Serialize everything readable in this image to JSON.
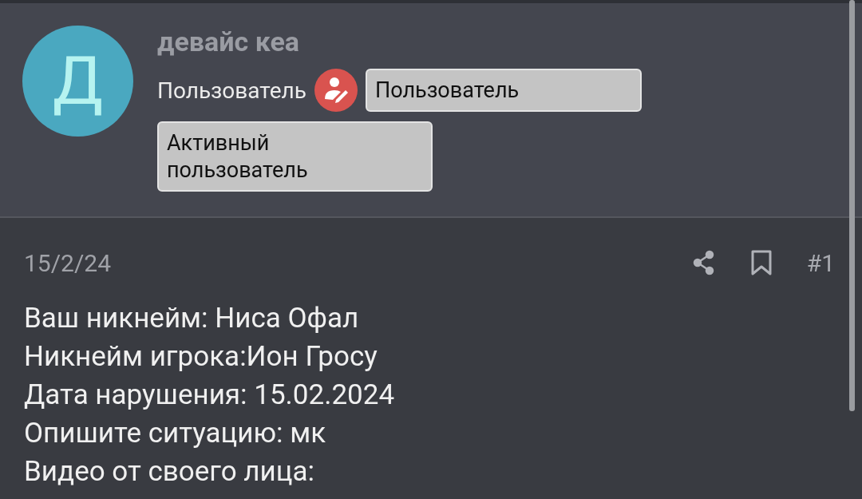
{
  "user": {
    "avatar_letter": "Д",
    "name": "девайс кеа",
    "role": "Пользователь",
    "tags": [
      "Пользователь",
      "Активный пользователь"
    ]
  },
  "post": {
    "date": "15/2/24",
    "number": "#1",
    "lines": [
      "Ваш никнейм: Ниса Офал",
      "Никнейм игрока:Ион Гросу",
      "Дата нарушения: 15.02.2024",
      "Опишите ситуацию: мк",
      "Видео от своего лица:"
    ]
  }
}
